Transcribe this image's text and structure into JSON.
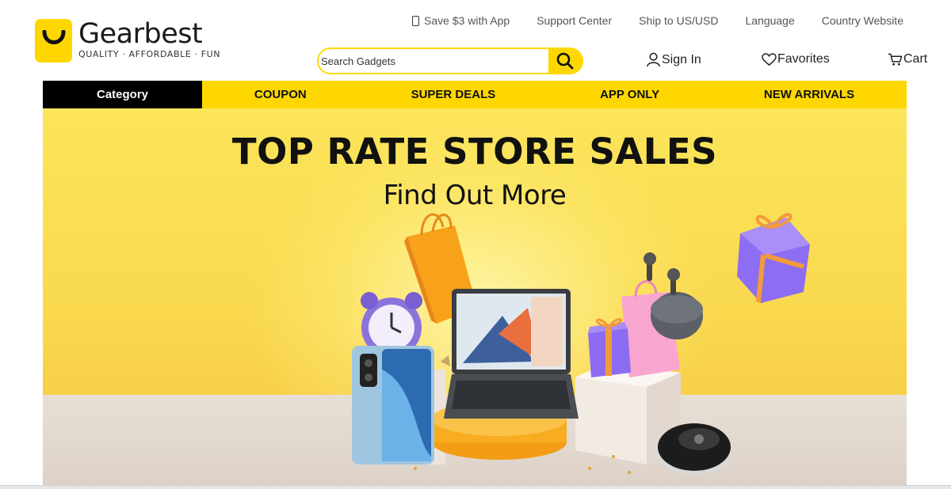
{
  "brand": {
    "name": "Gearbest",
    "tagline": "QUALITY · AFFORDABLE · FUN",
    "color": "#ffd700"
  },
  "top_links": [
    {
      "icon": "phone-icon",
      "label": "Save $3 with App"
    },
    {
      "label": "Support Center"
    },
    {
      "label": "Ship to US/USD"
    },
    {
      "label": "Language"
    },
    {
      "label": "Country Website"
    }
  ],
  "search": {
    "placeholder": "Search Gadgets",
    "value": "",
    "icon": "search-icon"
  },
  "account": {
    "signin": "Sign In",
    "favorites": "Favorites",
    "cart": "Cart"
  },
  "nav": {
    "category": "Category",
    "items": [
      "COUPON",
      "SUPER DEALS",
      "APP ONLY",
      "NEW ARRIVALS"
    ]
  },
  "banner": {
    "title": "TOP RATE STORE SALES",
    "subtitle": "Find Out More",
    "products": [
      "shopping-bag",
      "alarm-clock",
      "smartphone",
      "laptop",
      "gift-box",
      "earbuds",
      "robot-vacuum"
    ]
  }
}
